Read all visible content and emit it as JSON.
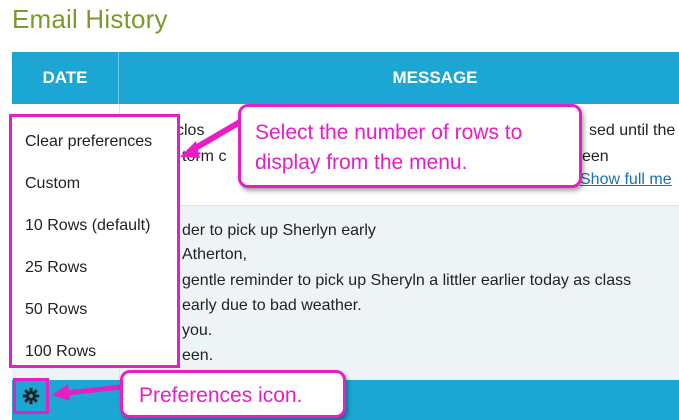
{
  "page": {
    "title": "Email History"
  },
  "table": {
    "headers": {
      "date": "DATE",
      "message": "MESSAGE"
    },
    "row1": {
      "line1_left": "l clos",
      "line1_right": "sed until the",
      "line2_left": "torm c",
      "line2_right": "een",
      "show_full_label": "Show full me"
    },
    "row2": {
      "lines": [
        "der to pick up Sherlyn early",
        "Atherton,",
        "gentle reminder to pick up Sheryln a littler earlier today as class",
        "early due to bad weather.",
        "you.",
        "een."
      ]
    }
  },
  "preferences_menu": {
    "items": [
      "Clear preferences",
      "Custom",
      "10 Rows (default)",
      "25 Rows",
      "50 Rows",
      "100 Rows"
    ]
  },
  "preferences_icon": {
    "icon": "gear-icon"
  },
  "callouts": {
    "menu_hint": "Select the number of rows to display from the menu.",
    "icon_hint": "Preferences icon."
  },
  "colors": {
    "title": "#7a9a2a",
    "header_bg": "#1ba6d4",
    "highlight": "#e61ec4",
    "link": "#1a6fb0"
  }
}
